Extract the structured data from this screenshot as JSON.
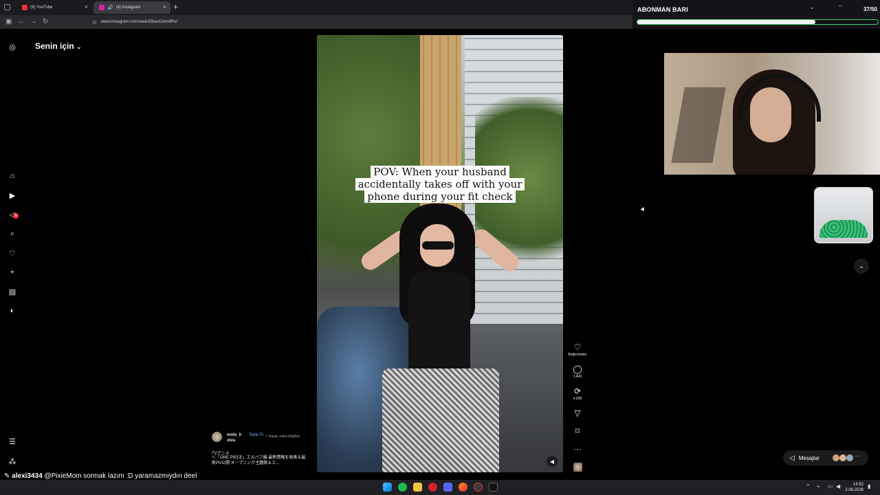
{
  "browser": {
    "tabs": [
      {
        "label": "(9) YouTube"
      },
      {
        "label": "(4) Instagram"
      }
    ],
    "url": "www.instagram.com/reels/DbauOuho8Rv/"
  },
  "overlay": {
    "title": "ABONMAN BARI",
    "count": "37/50",
    "progress": 0.74
  },
  "instagram": {
    "feed_label": "Senin için",
    "reel_caption": "POV: When your husband accidentally takes off with your phone during your fit check",
    "actions": {
      "like_label": "Beğenmeler",
      "comments": "1.443",
      "reposts": "4.039"
    },
    "author": {
      "name": "molo_h olva",
      "follow": "Takip Et",
      "ai_info": "• Yapay zeka bilgileri",
      "desc_line1": "TVアニメ",
      "desc_line2": "＜『ONE PIECE』エルバフ編 最新情報を発表＆最新PV公開 オープニング主題歌＆エ..."
    },
    "messages_label": "Mesajlar",
    "notification_badge": "4"
  },
  "chat": {
    "user": "alexi3434",
    "message": "@PixieMom sormak lazım :D yaramazmıydın deel miydinm"
  },
  "taskbar": {
    "time": "14:52",
    "date": "2.08.2026"
  }
}
